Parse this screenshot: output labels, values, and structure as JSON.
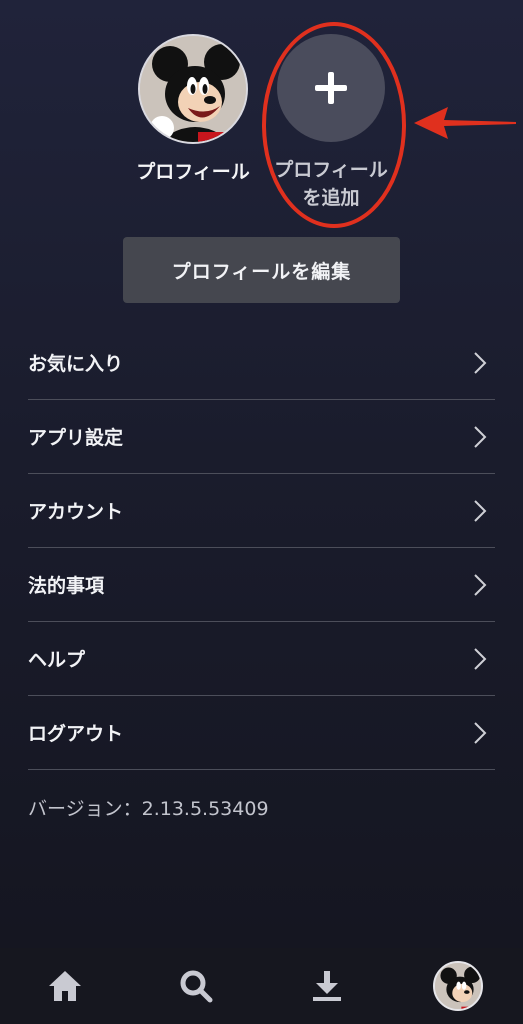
{
  "profiles": [
    {
      "name": "プロフィール",
      "avatar_icon": "mickey-mouse-avatar"
    },
    {
      "name": "プロフィール\nを追加",
      "icon": "plus-icon"
    }
  ],
  "edit_profile_label": "プロフィールを編集",
  "menu": [
    {
      "label": "お気に入り"
    },
    {
      "label": "アプリ設定"
    },
    {
      "label": "アカウント"
    },
    {
      "label": "法的事項"
    },
    {
      "label": "ヘルプ"
    },
    {
      "label": "ログアウト"
    }
  ],
  "version_text": "バージョン：2.13.5.53409",
  "annotation": {
    "color": "#e0301e"
  },
  "bottom_nav": [
    {
      "icon": "home-icon"
    },
    {
      "icon": "search-icon"
    },
    {
      "icon": "download-icon"
    },
    {
      "icon": "profile-avatar-icon"
    }
  ]
}
